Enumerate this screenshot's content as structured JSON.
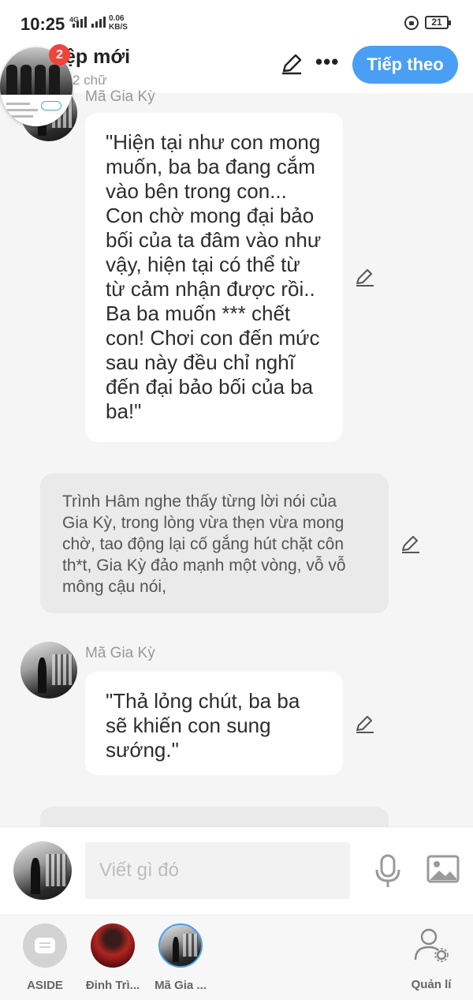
{
  "status": {
    "time": "10:25",
    "network": "4G",
    "speed_value": "0.06",
    "speed_unit": "KB/S",
    "battery": "21"
  },
  "header": {
    "title": "ệp mới",
    "word_count": "2 chữ",
    "next_label": "Tiếp theo",
    "more_label": "•••",
    "notification_count": "2"
  },
  "messages": [
    {
      "type": "character",
      "name": "Mã Gia Kỳ",
      "text": "\"Hiện tại như con mong muốn, ba ba đang cắm vào bên trong con... Con chờ mong đại bảo bối của ta đâm vào như vậy, hiện tại có thể từ từ cảm nhận được rồi.. Ba ba muốn *** chết con! Chơi con đến mức sau này đều chỉ nghĩ đến đại bảo bối của ba ba!\""
    },
    {
      "type": "narration",
      "text": "Trình Hâm nghe thấy từng lời nói của Gia Kỳ, trong lòng vừa thẹn vừa mong chờ, tao động lại cố gắng hút chặt côn th*t, Gia Kỳ đảo mạnh một vòng, vỗ vỗ mông cậu nói,"
    },
    {
      "type": "character",
      "name": "Mã Gia Kỳ",
      "text": "\"Thả lỏng chút, ba ba sẽ khiến con sung sướng.\""
    }
  ],
  "input": {
    "placeholder": "Viết gì đó"
  },
  "nav": [
    {
      "label": "ASIDE"
    },
    {
      "label": "Đinh Trì..."
    },
    {
      "label": "Mã Gia ..."
    },
    {
      "label": "Quản lí"
    }
  ],
  "colors": {
    "accent": "#4a9ff5",
    "badge": "#f0433b"
  }
}
